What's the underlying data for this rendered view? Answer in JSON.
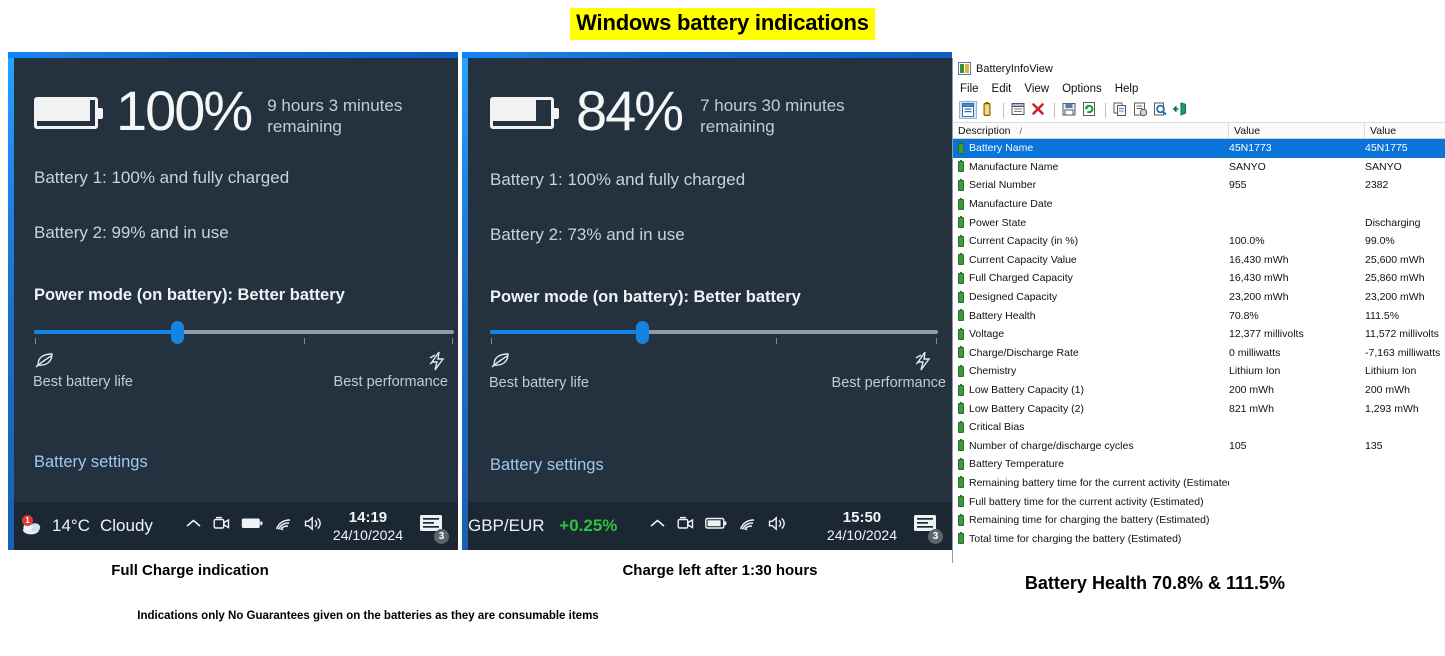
{
  "title": "Windows battery indications",
  "panels": [
    {
      "id": "full-charge",
      "percent": "100%",
      "battery_fill_ratio": 1.0,
      "remaining": "9 hours 3 minutes remaining",
      "battery1": "Battery 1: 100% and fully charged",
      "battery2": "Battery 2: 99% and in use",
      "power_mode": "Power mode (on battery): Better battery",
      "slider_position_pct": 34,
      "best_battery_life": "Best battery life",
      "best_performance": "Best performance",
      "battery_settings": "Battery settings",
      "caption": "Full Charge indication",
      "taskbar": {
        "left_kind": "weather",
        "temperature": "14°C",
        "condition": "Cloudy",
        "notification_count": "1",
        "time": "14:19",
        "date": "24/10/2024",
        "action_center_count": "3"
      }
    },
    {
      "id": "charge-left",
      "percent": "84%",
      "battery_fill_ratio": 0.84,
      "remaining": "7 hours 30 minutes remaining",
      "battery1": "Battery 1: 100% and fully charged",
      "battery2": "Battery 2: 73% and in use",
      "power_mode": "Power mode (on battery): Better battery",
      "slider_position_pct": 34,
      "best_battery_life": "Best battery life",
      "best_performance": "Best performance",
      "battery_settings": "Battery settings",
      "caption": "Charge left after 1:30 hours",
      "taskbar": {
        "left_kind": "fx",
        "fx_pair": "GBP/EUR",
        "fx_move": "+0.25%",
        "time": "15:50",
        "date": "24/10/2024",
        "action_center_count": "3"
      }
    }
  ],
  "battery_info_view": {
    "app_title": "BatteryInfoView",
    "menus": [
      "File",
      "Edit",
      "View",
      "Options",
      "Help"
    ],
    "toolbar_icons": [
      "properties-icon",
      "battery-icon",
      "window-icon",
      "delete-icon",
      "save-icon",
      "refresh-icon",
      "copy-icon",
      "options-icon",
      "find-icon",
      "exit-icon"
    ],
    "columns": [
      "Description",
      "Value",
      "Value"
    ],
    "sort_indicator": "/",
    "rows": [
      {
        "description": "Battery Name",
        "v1": "45N1773",
        "v2": "45N1775",
        "selected": true
      },
      {
        "description": "Manufacture Name",
        "v1": "SANYO",
        "v2": "SANYO",
        "selected": false
      },
      {
        "description": "Serial Number",
        "v1": "955",
        "v2": "2382",
        "selected": false
      },
      {
        "description": "Manufacture Date",
        "v1": "",
        "v2": "",
        "selected": false
      },
      {
        "description": "Power State",
        "v1": "",
        "v2": "Discharging",
        "selected": false
      },
      {
        "description": "Current Capacity (in %)",
        "v1": "100.0%",
        "v2": "99.0%",
        "selected": false
      },
      {
        "description": "Current Capacity Value",
        "v1": "16,430 mWh",
        "v2": "25,600 mWh",
        "selected": false
      },
      {
        "description": "Full Charged Capacity",
        "v1": "16,430 mWh",
        "v2": "25,860 mWh",
        "selected": false
      },
      {
        "description": "Designed Capacity",
        "v1": "23,200 mWh",
        "v2": "23,200 mWh",
        "selected": false
      },
      {
        "description": "Battery Health",
        "v1": "70.8%",
        "v2": "111.5%",
        "selected": false
      },
      {
        "description": "Voltage",
        "v1": "12,377 millivolts",
        "v2": "11,572 millivolts",
        "selected": false
      },
      {
        "description": "Charge/Discharge Rate",
        "v1": "0 milliwatts",
        "v2": "-7,163 milliwatts",
        "selected": false
      },
      {
        "description": "Chemistry",
        "v1": "Lithium Ion",
        "v2": "Lithium Ion",
        "selected": false
      },
      {
        "description": "Low Battery Capacity (1)",
        "v1": "200 mWh",
        "v2": "200 mWh",
        "selected": false
      },
      {
        "description": "Low Battery Capacity (2)",
        "v1": "821 mWh",
        "v2": "1,293 mWh",
        "selected": false
      },
      {
        "description": "Critical Bias",
        "v1": "",
        "v2": "",
        "selected": false
      },
      {
        "description": "Number of charge/discharge cycles",
        "v1": "105",
        "v2": "135",
        "selected": false
      },
      {
        "description": "Battery Temperature",
        "v1": "",
        "v2": "",
        "selected": false
      },
      {
        "description": "Remaining battery time for the current activity (Estimated)",
        "v1": "",
        "v2": "",
        "selected": false
      },
      {
        "description": "Full battery time for the current activity (Estimated)",
        "v1": "",
        "v2": "",
        "selected": false
      },
      {
        "description": "Remaining time for charging the battery (Estimated)",
        "v1": "",
        "v2": "",
        "selected": false
      },
      {
        "description": "Total  time for charging the battery (Estimated)",
        "v1": "",
        "v2": "",
        "selected": false
      }
    ],
    "caption": "Battery Health 70.8% & 111.5%"
  },
  "disclaimer": "Indications only No Guarantees given on the batteries as they are consumable items",
  "colors": {
    "highlight_yellow": "#ffff00",
    "flyout_bg": "#24323f",
    "accent_blue": "#1484e0",
    "selection_blue": "#0a74d8",
    "fx_green": "#2fc23d",
    "link_blue": "#9fc8f0"
  }
}
